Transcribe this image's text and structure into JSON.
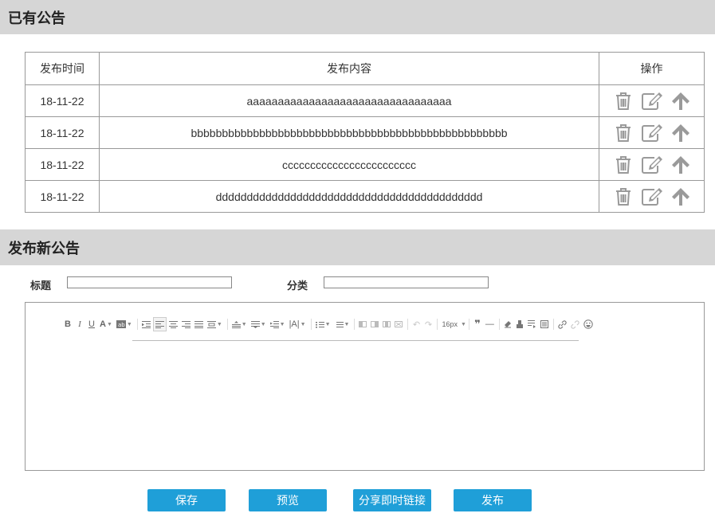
{
  "existing": {
    "title": "已有公告",
    "columns": {
      "time": "发布时间",
      "content": "发布内容",
      "ops": "操作"
    },
    "rows": [
      {
        "time": "18-11-22",
        "content": "aaaaaaaaaaaaaaaaaaaaaaaaaaaaaaaaa"
      },
      {
        "time": "18-11-22",
        "content": "bbbbbbbbbbbbbbbbbbbbbbbbbbbbbbbbbbbbbbbbbbbbbbbbbbb"
      },
      {
        "time": "18-11-22",
        "content": "cccccccccccccccccccccccc"
      },
      {
        "time": "18-11-22",
        "content": "ddddddddddddddddddddddddddddddddddddddddddd"
      }
    ],
    "row_actions": [
      "trash-icon",
      "edit-icon",
      "arrow-up-icon"
    ]
  },
  "publish": {
    "title": "发布新公告",
    "title_label": "标题",
    "title_value": "",
    "category_label": "分类",
    "category_value": "",
    "editor": {
      "font_size": "16px",
      "toolbar": [
        "bold-icon",
        "italic-icon",
        "underline-icon",
        "font-color-icon",
        "highlight-icon",
        "indent-icon",
        "align-left-icon",
        "align-center-icon",
        "align-right-icon",
        "align-justify-icon",
        "paragraph-icon",
        "line-height-icon",
        "text-align-icon",
        "font-family-icon",
        "letter-spacing-icon",
        "ordered-list-icon",
        "unordered-list-icon",
        "table-icons",
        "undo-icon",
        "redo-icon",
        "quote-icon",
        "horizontal-rule-icon",
        "clear-format-icon",
        "format-brush-icon",
        "insert-code-icon",
        "insert-page-icon",
        "link-icon",
        "unlink-icon",
        "emoji-icon"
      ]
    },
    "buttons": {
      "save": "保存",
      "preview": "预览",
      "share": "分享即时链接",
      "publish": "发布"
    }
  },
  "colors": {
    "section_bg": "#d6d6d6",
    "button_bg": "#1f9fd8",
    "icon_gray": "#9a9a9a"
  }
}
